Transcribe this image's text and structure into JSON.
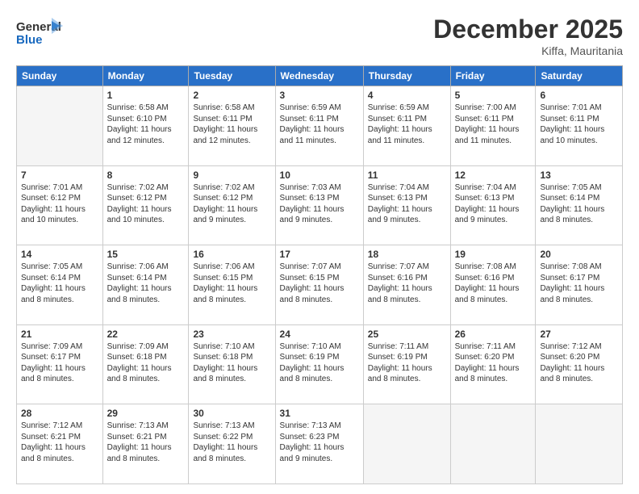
{
  "header": {
    "logo_general": "General",
    "logo_blue": "Blue",
    "month_year": "December 2025",
    "location": "Kiffa, Mauritania"
  },
  "columns": [
    "Sunday",
    "Monday",
    "Tuesday",
    "Wednesday",
    "Thursday",
    "Friday",
    "Saturday"
  ],
  "weeks": [
    [
      {
        "day": "",
        "sunrise": "",
        "sunset": "",
        "daylight": "",
        "empty": true
      },
      {
        "day": "1",
        "sunrise": "Sunrise: 6:58 AM",
        "sunset": "Sunset: 6:10 PM",
        "daylight": "Daylight: 11 hours and 12 minutes."
      },
      {
        "day": "2",
        "sunrise": "Sunrise: 6:58 AM",
        "sunset": "Sunset: 6:11 PM",
        "daylight": "Daylight: 11 hours and 12 minutes."
      },
      {
        "day": "3",
        "sunrise": "Sunrise: 6:59 AM",
        "sunset": "Sunset: 6:11 PM",
        "daylight": "Daylight: 11 hours and 11 minutes."
      },
      {
        "day": "4",
        "sunrise": "Sunrise: 6:59 AM",
        "sunset": "Sunset: 6:11 PM",
        "daylight": "Daylight: 11 hours and 11 minutes."
      },
      {
        "day": "5",
        "sunrise": "Sunrise: 7:00 AM",
        "sunset": "Sunset: 6:11 PM",
        "daylight": "Daylight: 11 hours and 11 minutes."
      },
      {
        "day": "6",
        "sunrise": "Sunrise: 7:01 AM",
        "sunset": "Sunset: 6:11 PM",
        "daylight": "Daylight: 11 hours and 10 minutes."
      }
    ],
    [
      {
        "day": "7",
        "sunrise": "Sunrise: 7:01 AM",
        "sunset": "Sunset: 6:12 PM",
        "daylight": "Daylight: 11 hours and 10 minutes."
      },
      {
        "day": "8",
        "sunrise": "Sunrise: 7:02 AM",
        "sunset": "Sunset: 6:12 PM",
        "daylight": "Daylight: 11 hours and 10 minutes."
      },
      {
        "day": "9",
        "sunrise": "Sunrise: 7:02 AM",
        "sunset": "Sunset: 6:12 PM",
        "daylight": "Daylight: 11 hours and 9 minutes."
      },
      {
        "day": "10",
        "sunrise": "Sunrise: 7:03 AM",
        "sunset": "Sunset: 6:13 PM",
        "daylight": "Daylight: 11 hours and 9 minutes."
      },
      {
        "day": "11",
        "sunrise": "Sunrise: 7:04 AM",
        "sunset": "Sunset: 6:13 PM",
        "daylight": "Daylight: 11 hours and 9 minutes."
      },
      {
        "day": "12",
        "sunrise": "Sunrise: 7:04 AM",
        "sunset": "Sunset: 6:13 PM",
        "daylight": "Daylight: 11 hours and 9 minutes."
      },
      {
        "day": "13",
        "sunrise": "Sunrise: 7:05 AM",
        "sunset": "Sunset: 6:14 PM",
        "daylight": "Daylight: 11 hours and 8 minutes."
      }
    ],
    [
      {
        "day": "14",
        "sunrise": "Sunrise: 7:05 AM",
        "sunset": "Sunset: 6:14 PM",
        "daylight": "Daylight: 11 hours and 8 minutes."
      },
      {
        "day": "15",
        "sunrise": "Sunrise: 7:06 AM",
        "sunset": "Sunset: 6:14 PM",
        "daylight": "Daylight: 11 hours and 8 minutes."
      },
      {
        "day": "16",
        "sunrise": "Sunrise: 7:06 AM",
        "sunset": "Sunset: 6:15 PM",
        "daylight": "Daylight: 11 hours and 8 minutes."
      },
      {
        "day": "17",
        "sunrise": "Sunrise: 7:07 AM",
        "sunset": "Sunset: 6:15 PM",
        "daylight": "Daylight: 11 hours and 8 minutes."
      },
      {
        "day": "18",
        "sunrise": "Sunrise: 7:07 AM",
        "sunset": "Sunset: 6:16 PM",
        "daylight": "Daylight: 11 hours and 8 minutes."
      },
      {
        "day": "19",
        "sunrise": "Sunrise: 7:08 AM",
        "sunset": "Sunset: 6:16 PM",
        "daylight": "Daylight: 11 hours and 8 minutes."
      },
      {
        "day": "20",
        "sunrise": "Sunrise: 7:08 AM",
        "sunset": "Sunset: 6:17 PM",
        "daylight": "Daylight: 11 hours and 8 minutes."
      }
    ],
    [
      {
        "day": "21",
        "sunrise": "Sunrise: 7:09 AM",
        "sunset": "Sunset: 6:17 PM",
        "daylight": "Daylight: 11 hours and 8 minutes."
      },
      {
        "day": "22",
        "sunrise": "Sunrise: 7:09 AM",
        "sunset": "Sunset: 6:18 PM",
        "daylight": "Daylight: 11 hours and 8 minutes."
      },
      {
        "day": "23",
        "sunrise": "Sunrise: 7:10 AM",
        "sunset": "Sunset: 6:18 PM",
        "daylight": "Daylight: 11 hours and 8 minutes."
      },
      {
        "day": "24",
        "sunrise": "Sunrise: 7:10 AM",
        "sunset": "Sunset: 6:19 PM",
        "daylight": "Daylight: 11 hours and 8 minutes."
      },
      {
        "day": "25",
        "sunrise": "Sunrise: 7:11 AM",
        "sunset": "Sunset: 6:19 PM",
        "daylight": "Daylight: 11 hours and 8 minutes."
      },
      {
        "day": "26",
        "sunrise": "Sunrise: 7:11 AM",
        "sunset": "Sunset: 6:20 PM",
        "daylight": "Daylight: 11 hours and 8 minutes."
      },
      {
        "day": "27",
        "sunrise": "Sunrise: 7:12 AM",
        "sunset": "Sunset: 6:20 PM",
        "daylight": "Daylight: 11 hours and 8 minutes."
      }
    ],
    [
      {
        "day": "28",
        "sunrise": "Sunrise: 7:12 AM",
        "sunset": "Sunset: 6:21 PM",
        "daylight": "Daylight: 11 hours and 8 minutes."
      },
      {
        "day": "29",
        "sunrise": "Sunrise: 7:13 AM",
        "sunset": "Sunset: 6:21 PM",
        "daylight": "Daylight: 11 hours and 8 minutes."
      },
      {
        "day": "30",
        "sunrise": "Sunrise: 7:13 AM",
        "sunset": "Sunset: 6:22 PM",
        "daylight": "Daylight: 11 hours and 8 minutes."
      },
      {
        "day": "31",
        "sunrise": "Sunrise: 7:13 AM",
        "sunset": "Sunset: 6:23 PM",
        "daylight": "Daylight: 11 hours and 9 minutes."
      },
      {
        "day": "",
        "sunrise": "",
        "sunset": "",
        "daylight": "",
        "empty": true
      },
      {
        "day": "",
        "sunrise": "",
        "sunset": "",
        "daylight": "",
        "empty": true
      },
      {
        "day": "",
        "sunrise": "",
        "sunset": "",
        "daylight": "",
        "empty": true
      }
    ]
  ]
}
